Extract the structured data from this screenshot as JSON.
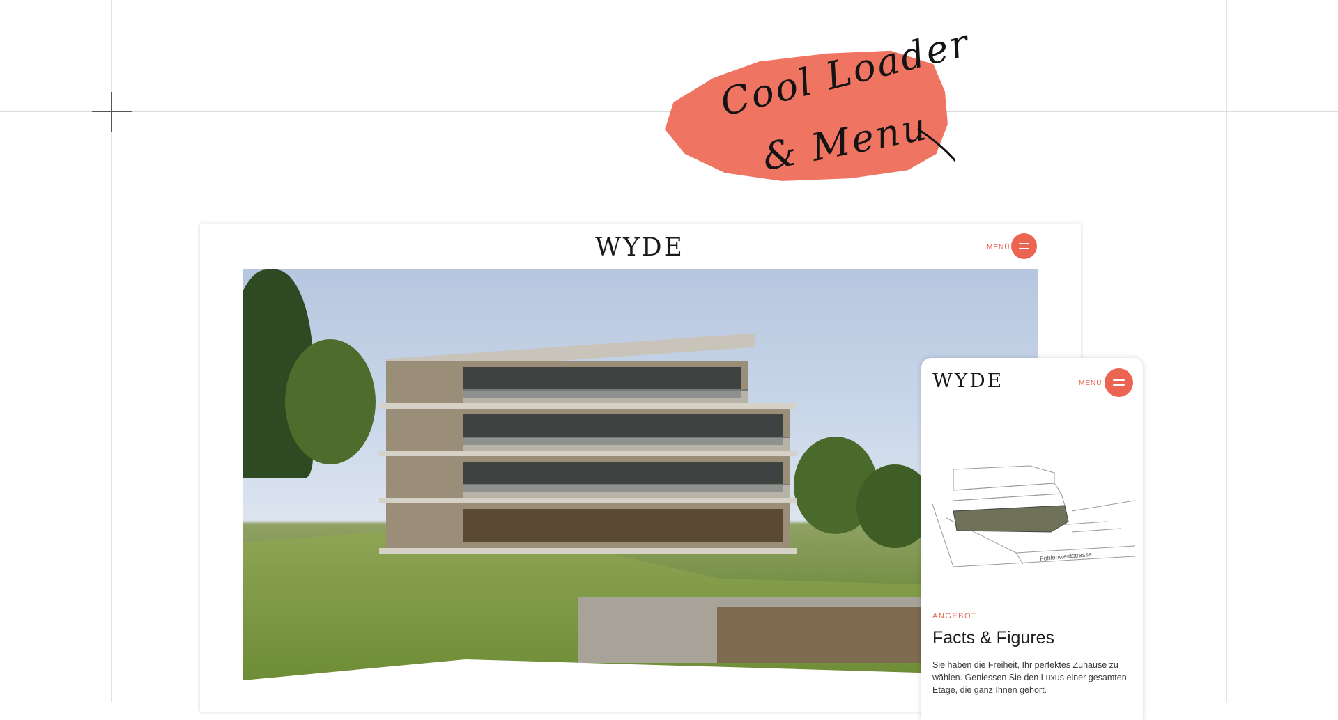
{
  "annotation": {
    "line1": "Cool Loader",
    "line2": "& Menu",
    "brush_color": "#ee6a57"
  },
  "desktop": {
    "logo": "WYDE",
    "menu_label": "MENÜ",
    "menu_icon": "hamburger-icon",
    "hero_image": "residential-building-render"
  },
  "mobile": {
    "logo": "WYDE",
    "menu_label": "MENÜ",
    "menu_icon": "hamburger-icon",
    "drawing": "floor-plan-building-sketch",
    "street_label": "Fohlenweidstrasse",
    "eyebrow": "ANGEBOT",
    "title": "Facts & Figures",
    "text": "Sie haben die Freiheit, Ihr perfektes Zuhause zu wählen. Geniessen Sie den Luxus einer gesamten Etage, die ganz Ihnen gehört."
  },
  "colors": {
    "accent": "#ec6552",
    "logo": "#1a1a1a"
  }
}
